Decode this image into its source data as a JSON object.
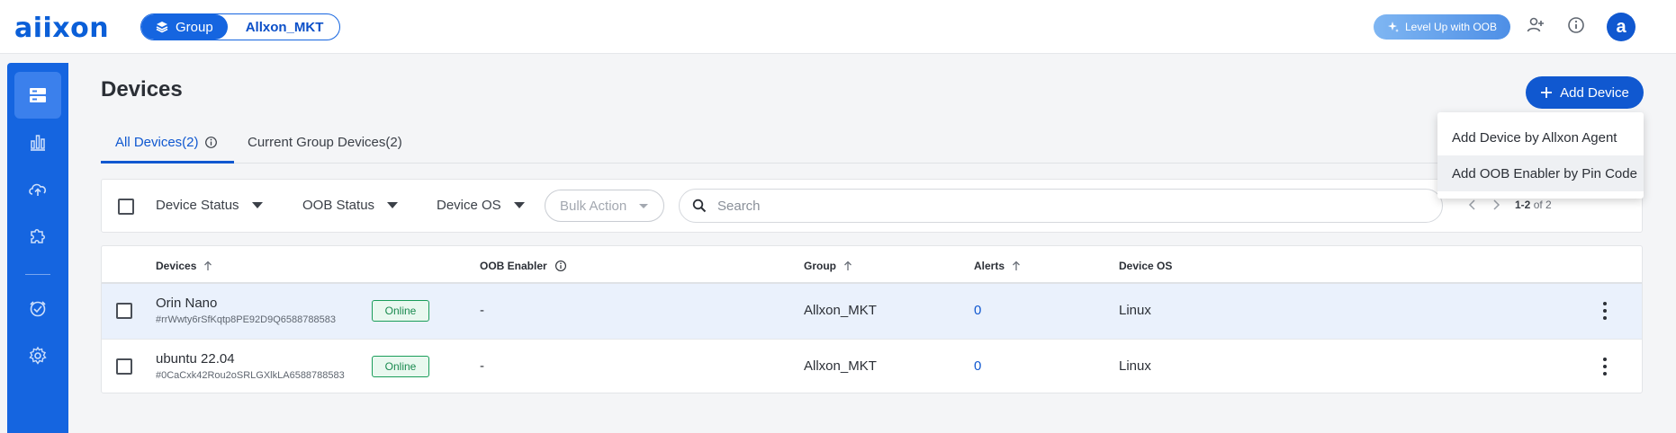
{
  "brand": {
    "logo": "aiixon",
    "accent": "#1565e0"
  },
  "header": {
    "group_label": "Group",
    "group_name": "Allxon_MKT",
    "level_up": "Level Up with OOB",
    "avatar_letter": "a",
    "icons": [
      "add-user-icon",
      "info-icon"
    ]
  },
  "sidebar": {
    "items": [
      {
        "icon": "devices-icon",
        "active": true
      },
      {
        "icon": "analytics-icon",
        "active": false
      },
      {
        "icon": "cloud-upload-icon",
        "active": false
      },
      {
        "icon": "plugin-icon",
        "active": false
      },
      {
        "icon": "support-icon",
        "active": false
      },
      {
        "icon": "settings-icon",
        "active": false
      }
    ]
  },
  "page": {
    "title": "Devices",
    "add_button": "Add Device",
    "tabs": [
      {
        "label": "All Devices(2)",
        "active": true
      },
      {
        "label": "Current Group Devices(2)",
        "active": false
      }
    ]
  },
  "filters": {
    "device_status": "Device Status",
    "oob_status": "OOB Status",
    "device_os": "Device OS",
    "bulk_action": "Bulk Action",
    "search_placeholder": "Search",
    "pager_range": "1-2",
    "pager_total": "of 2"
  },
  "table": {
    "columns": [
      "Devices",
      "OOB Enabler",
      "Group",
      "Alerts",
      "Device OS"
    ],
    "rows": [
      {
        "name": "Orin Nano",
        "id": "#rrWwty6rSfKqtp8PE92D9Q6588788583",
        "status": "Online",
        "oob": "-",
        "group": "Allxon_MKT",
        "alerts": "0",
        "os": "Linux"
      },
      {
        "name": "ubuntu 22.04",
        "id": "#0CaCxk42Rou2oSRLGXlkLA6588788583",
        "status": "Online",
        "oob": "-",
        "group": "Allxon_MKT",
        "alerts": "0",
        "os": "Linux"
      }
    ]
  },
  "add_menu": {
    "items": [
      "Add Device by Allxon Agent",
      "Add OOB Enabler by Pin Code"
    ]
  }
}
